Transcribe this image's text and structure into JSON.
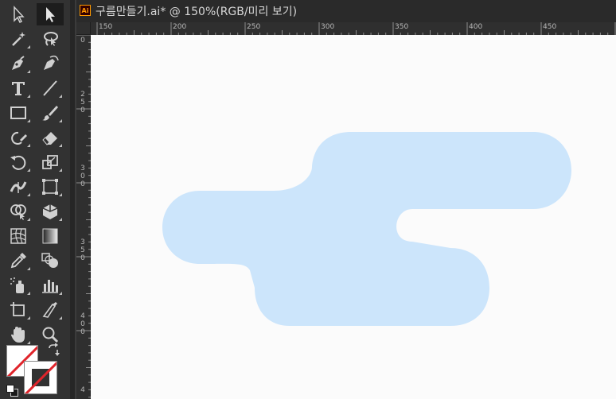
{
  "document": {
    "app_badge": "Ai",
    "title": "구름만들기.ai* @ 150%(RGB/미리 보기)"
  },
  "rulers": {
    "horizontal_labels": [
      "150",
      "200",
      "250",
      "300",
      "350",
      "400",
      "450"
    ],
    "vertical_labels": [
      "0",
      "250",
      "300",
      "350",
      "400",
      "4"
    ]
  },
  "colors": {
    "cloud_fill": "#cce5fb",
    "canvas": "#fbfbfb",
    "toolbar": "#323232"
  },
  "tools": [
    "selection-tool",
    "direct-selection-tool",
    "magic-wand-tool",
    "lasso-tool",
    "pen-tool",
    "curvature-tool",
    "type-tool",
    "line-segment-tool",
    "rectangle-tool",
    "paintbrush-tool",
    "shaper-tool",
    "eraser-tool",
    "rotate-tool",
    "scale-tool",
    "width-tool",
    "free-transform-tool",
    "shape-builder-tool",
    "perspective-grid-tool",
    "mesh-tool",
    "gradient-tool",
    "eyedropper-tool",
    "blend-tool",
    "symbol-sprayer-tool",
    "column-graph-tool",
    "artboard-tool",
    "slice-tool",
    "hand-tool",
    "zoom-tool"
  ]
}
